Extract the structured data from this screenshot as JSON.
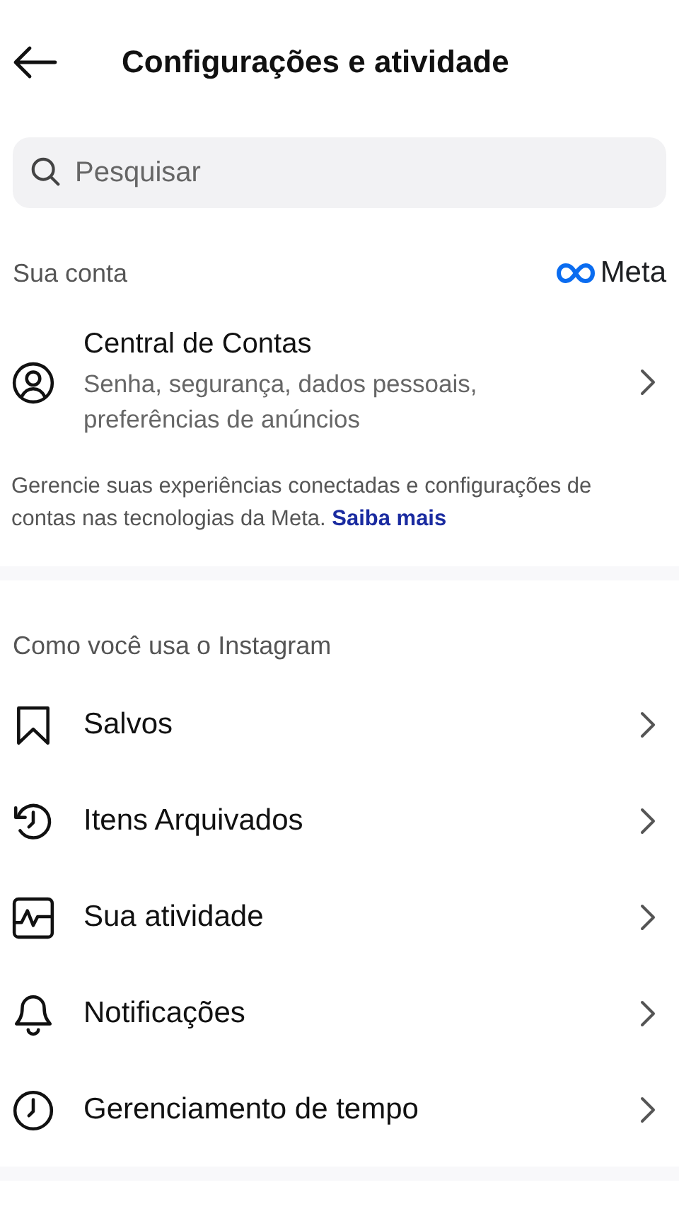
{
  "header": {
    "title": "Configurações e atividade"
  },
  "search": {
    "placeholder": "Pesquisar"
  },
  "account_section": {
    "heading": "Sua conta",
    "brand": "Meta",
    "item": {
      "title": "Central de Contas",
      "subtitle": "Senha, segurança, dados pessoais, preferências de anúncios"
    },
    "description": "Gerencie suas experiências conectadas e configurações de contas nas tecnologias da Meta.",
    "link": "Saiba mais"
  },
  "usage_section": {
    "heading": "Como você usa o Instagram",
    "items": [
      {
        "kind": "bookmark",
        "label": "Salvos"
      },
      {
        "kind": "history",
        "label": "Itens Arquivados"
      },
      {
        "kind": "activity",
        "label": "Sua atividade"
      },
      {
        "kind": "bell",
        "label": "Notificações"
      },
      {
        "kind": "clock",
        "label": "Gerenciamento de tempo"
      }
    ]
  }
}
